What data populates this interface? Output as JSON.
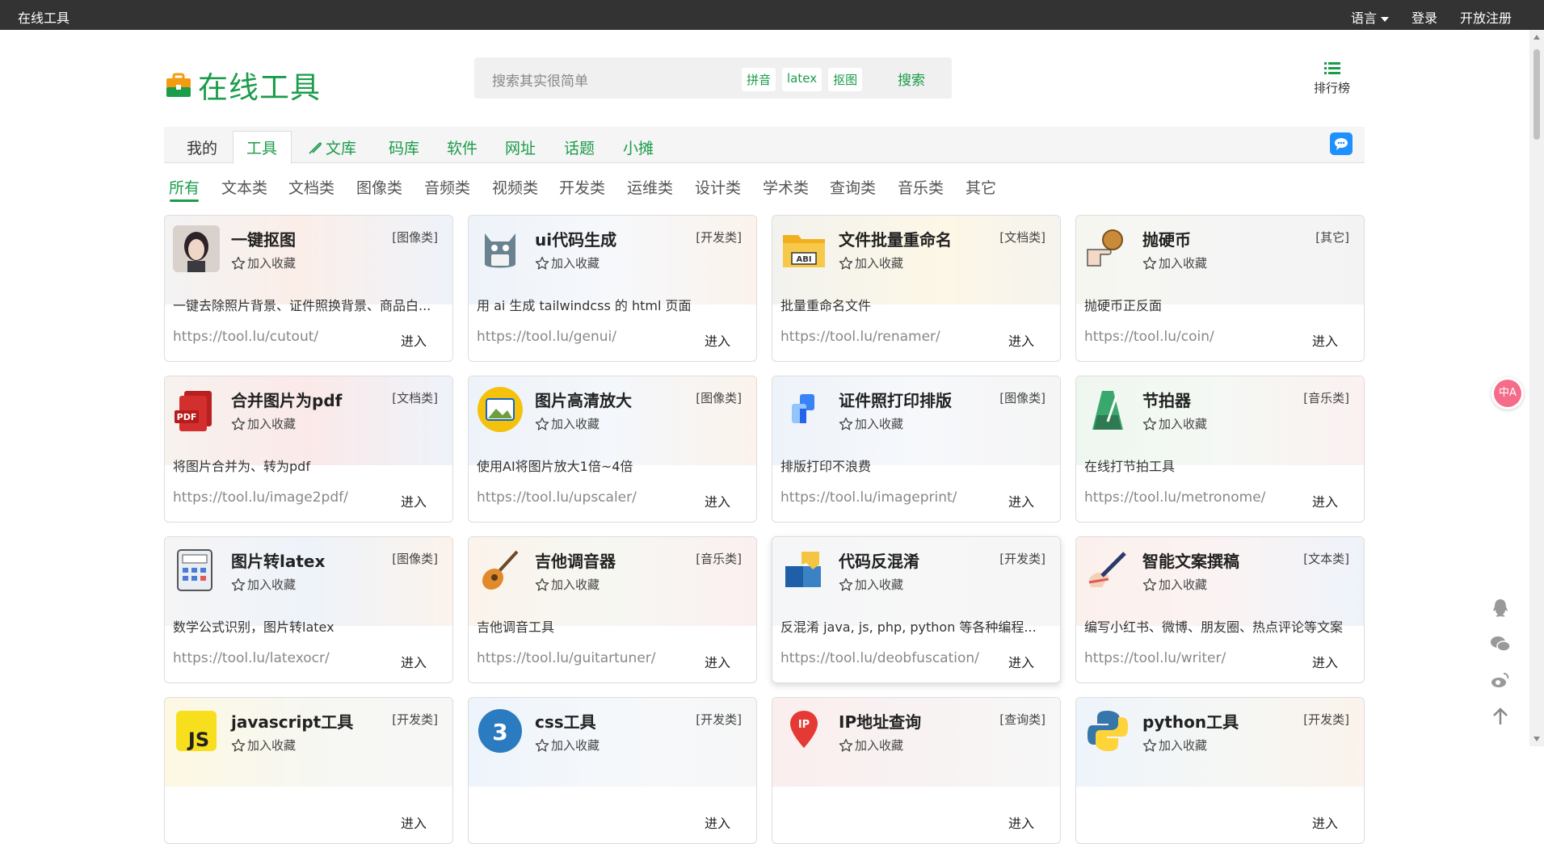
{
  "topbar": {
    "brand": "在线工具",
    "language": "语言",
    "login": "登录",
    "register": "开放注册"
  },
  "header": {
    "logo_text": "在线工具",
    "search_placeholder": "搜索其实很简单",
    "search_tags": [
      "拼音",
      "latex",
      "抠图"
    ],
    "search_button": "搜索",
    "rank_label": "排行榜"
  },
  "mainnav": {
    "items": [
      "我的",
      "工具",
      "文库",
      "码库",
      "软件",
      "网址",
      "话题",
      "小摊"
    ],
    "active": "工具"
  },
  "subnav": {
    "items": [
      "所有",
      "文本类",
      "文档类",
      "图像类",
      "音频类",
      "视频类",
      "开发类",
      "运维类",
      "设计类",
      "学术类",
      "查询类",
      "音乐类",
      "其它"
    ],
    "active": "所有"
  },
  "fav_label": "加入收藏",
  "enter_label": "进入",
  "cards": [
    {
      "title": "一键抠图",
      "category": "[图像类]",
      "desc": "一键去除照片背景、证件照换背景、商品白...",
      "url": "https://tool.lu/cutout/",
      "icon": "portrait-icon"
    },
    {
      "title": "ui代码生成",
      "category": "[开发类]",
      "desc": "用 ai 生成 tailwindcss 的 html 页面",
      "url": "https://tool.lu/genui/",
      "icon": "cat-mascot-icon"
    },
    {
      "title": "文件批量重命名",
      "category": "[文档类]",
      "desc": "批量重命名文件",
      "url": "https://tool.lu/renamer/",
      "icon": "folder-abi-icon"
    },
    {
      "title": "抛硬币",
      "category": "[其它]",
      "desc": "抛硬币正反面",
      "url": "https://tool.lu/coin/",
      "icon": "coin-hand-icon"
    },
    {
      "title": "合并图片为pdf",
      "category": "[文档类]",
      "desc": "将图片合并为、转为pdf",
      "url": "https://tool.lu/image2pdf/",
      "icon": "pdf-icon"
    },
    {
      "title": "图片高清放大",
      "category": "[图像类]",
      "desc": "使用AI将图片放大1倍~4倍",
      "url": "https://tool.lu/upscaler/",
      "icon": "picture-icon"
    },
    {
      "title": "证件照打印排版",
      "category": "[图像类]",
      "desc": "排版打印不浪费",
      "url": "https://tool.lu/imageprint/",
      "icon": "layout-blocks-icon"
    },
    {
      "title": "节拍器",
      "category": "[音乐类]",
      "desc": "在线打节拍工具",
      "url": "https://tool.lu/metronome/",
      "icon": "metronome-icon"
    },
    {
      "title": "图片转latex",
      "category": "[图像类]",
      "desc": "数学公式识别，图片转latex",
      "url": "https://tool.lu/latexocr/",
      "icon": "calculator-icon"
    },
    {
      "title": "吉他调音器",
      "category": "[音乐类]",
      "desc": "吉他调音工具",
      "url": "https://tool.lu/guitartuner/",
      "icon": "guitar-icon"
    },
    {
      "title": "代码反混淆",
      "category": "[开发类]",
      "desc": "反混淆 java, js, php, python 等各种编程...",
      "url": "https://tool.lu/deobfuscation/",
      "icon": "puzzle-icon"
    },
    {
      "title": "智能文案撰稿",
      "category": "[文本类]",
      "desc": "编写小红书、微博、朋友圈、热点评论等文案",
      "url": "https://tool.lu/writer/",
      "icon": "pen-hand-icon"
    },
    {
      "title": "javascript工具",
      "category": "[开发类]",
      "desc": "",
      "url": "",
      "icon": "js-icon"
    },
    {
      "title": "css工具",
      "category": "[开发类]",
      "desc": "",
      "url": "",
      "icon": "css-icon"
    },
    {
      "title": "IP地址查询",
      "category": "[查询类]",
      "desc": "",
      "url": "",
      "icon": "ip-pin-icon"
    },
    {
      "title": "python工具",
      "category": "[开发类]",
      "desc": "",
      "url": "",
      "icon": "python-icon"
    }
  ],
  "float_badge": "中A",
  "colors": {
    "accent": "#1a9c4a",
    "topbar": "#333333",
    "chat": "#1e90ff"
  }
}
